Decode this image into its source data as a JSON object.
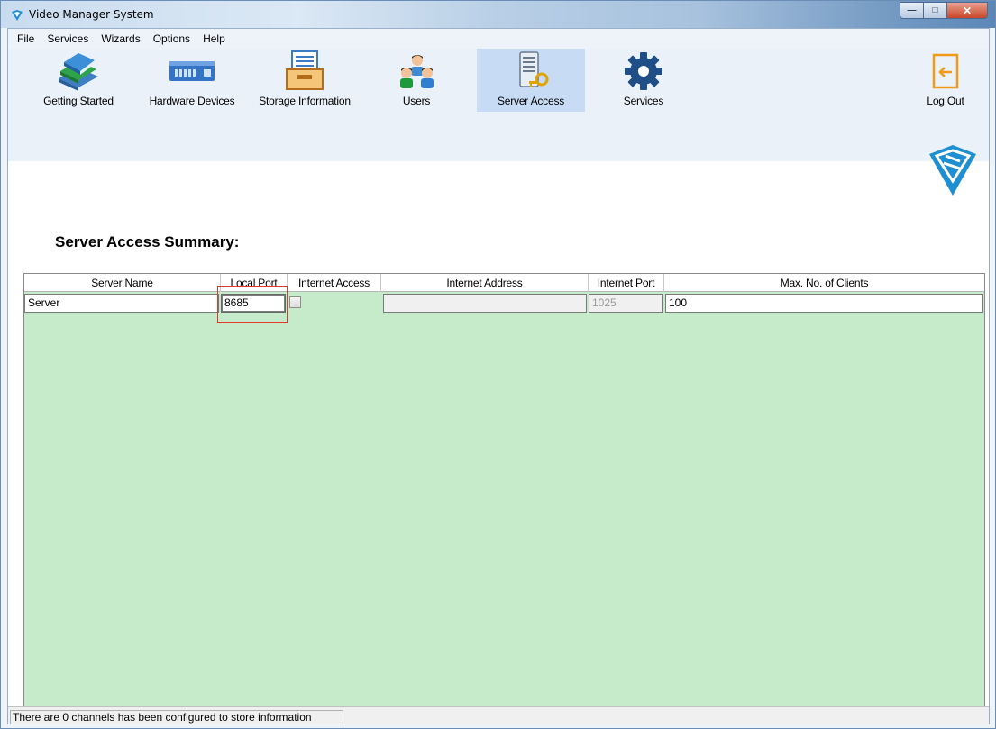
{
  "window": {
    "title": "Video Manager System",
    "minimize_glyph": "—",
    "maximize_glyph": "□",
    "close_glyph": "✕"
  },
  "menu": [
    "File",
    "Services",
    "Wizards",
    "Options",
    "Help"
  ],
  "toolbar": {
    "items": [
      {
        "label": "Getting Started",
        "icon": "books-icon"
      },
      {
        "label": "Hardware Devices",
        "icon": "device-icon"
      },
      {
        "label": "Storage Information",
        "icon": "storage-icon"
      },
      {
        "label": "Users",
        "icon": "users-icon"
      },
      {
        "label": "Server Access",
        "icon": "server-key-icon",
        "selected": true
      },
      {
        "label": "Services",
        "icon": "gear-icon"
      }
    ],
    "logout_label": "Log Out"
  },
  "summary": {
    "title": "Server Access Summary:"
  },
  "table": {
    "columns": [
      "Server Name",
      "Local Port",
      "Internet Access",
      "Internet Address",
      "Internet Port",
      "Max. No. of Clients"
    ],
    "row": {
      "server_name": "Server",
      "local_port": "8685",
      "internet_access": false,
      "internet_address": "",
      "internet_port": "1025",
      "max_clients": "100"
    }
  },
  "status": {
    "text": "There are 0 channels has been configured to store information"
  },
  "colors": {
    "table_background": "#c6ebcb",
    "selected_tool": "#c7dcf4",
    "highlight_border": "#e03a30",
    "brand": "#1e8fd0"
  }
}
